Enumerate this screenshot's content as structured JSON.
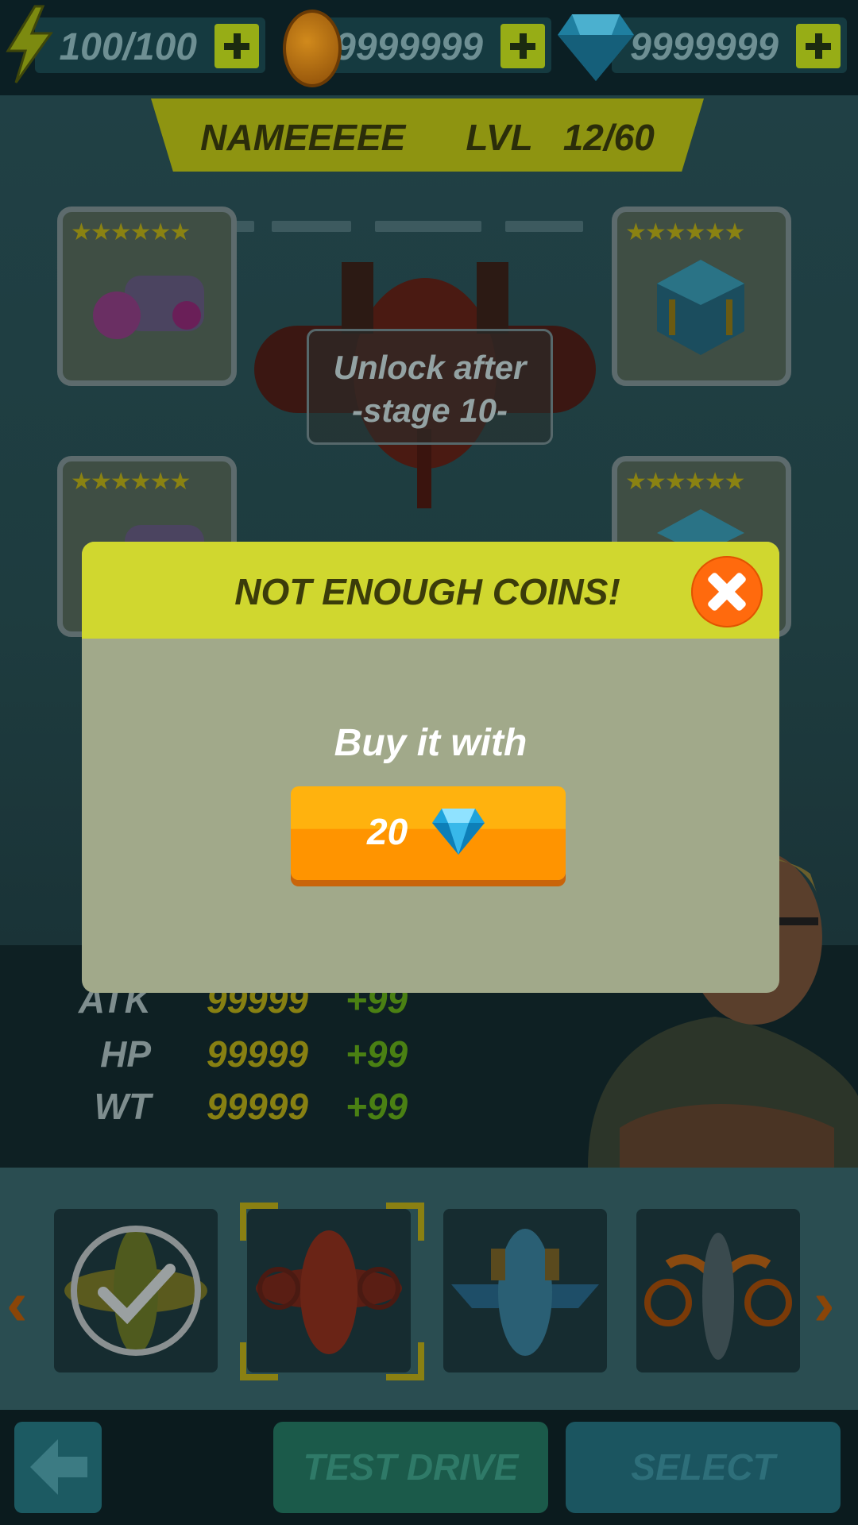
{
  "resources": {
    "energy": "100/100",
    "coins": "9999999",
    "gems": "9999999"
  },
  "banner": {
    "name": "NAMEEEEE",
    "level_label": "LVL",
    "level_value": "12/60"
  },
  "slots": {
    "star_count": 6
  },
  "lock": {
    "line1": "Unlock after",
    "line2": "-stage 10-"
  },
  "stats": [
    {
      "label": "ATK",
      "value": "99999",
      "bonus": "+99"
    },
    {
      "label": "HP",
      "value": "99999",
      "bonus": "+99"
    },
    {
      "label": "WT",
      "value": "99999",
      "bonus": "+99"
    }
  ],
  "buttons": {
    "test_drive": "TEST DRIVE",
    "select": "SELECT"
  },
  "dialog": {
    "title": "NOT ENOUGH COINS!",
    "message": "Buy it with",
    "price": "20"
  },
  "colors": {
    "dialog_header": "#d0d72f",
    "dialog_body": "#a1a98a",
    "buy_button": "#ff9f05",
    "close_button": "#ff6a0d"
  }
}
